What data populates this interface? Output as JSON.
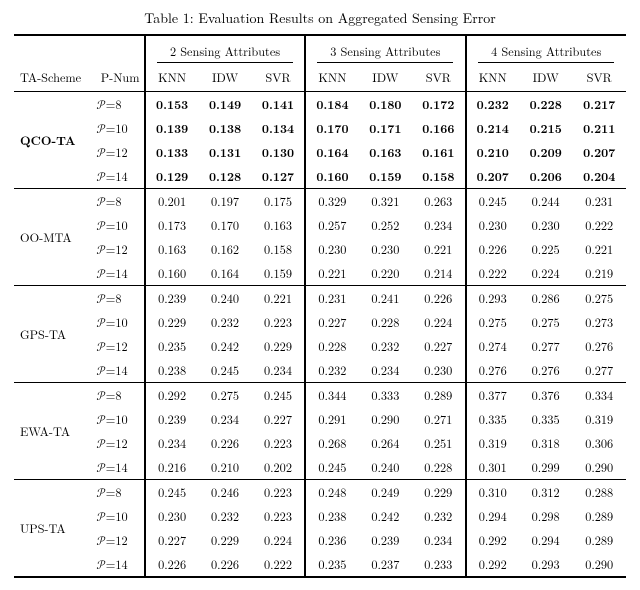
{
  "caption": "Table 1: Evaluation Results on Aggregated Sensing Error",
  "header": {
    "scheme": "TA-Scheme",
    "pnum": "P-Num",
    "groups": [
      "2 Sensing Attributes",
      "3 Sensing Attributes",
      "4 Sensing Attributes"
    ],
    "metrics": [
      "KNN",
      "IDW",
      "SVR"
    ]
  },
  "pnum_values": [
    "=8",
    "=10",
    "=12",
    "=14"
  ],
  "schemes": [
    {
      "name": "QCO-TA",
      "bold": true,
      "rows": [
        [
          "0.153",
          "0.149",
          "0.141",
          "0.184",
          "0.180",
          "0.172",
          "0.232",
          "0.228",
          "0.217"
        ],
        [
          "0.139",
          "0.138",
          "0.134",
          "0.170",
          "0.171",
          "0.166",
          "0.214",
          "0.215",
          "0.211"
        ],
        [
          "0.133",
          "0.131",
          "0.130",
          "0.164",
          "0.163",
          "0.161",
          "0.210",
          "0.209",
          "0.207"
        ],
        [
          "0.129",
          "0.128",
          "0.127",
          "0.160",
          "0.159",
          "0.158",
          "0.207",
          "0.206",
          "0.204"
        ]
      ]
    },
    {
      "name": "OO-MTA",
      "bold": false,
      "rows": [
        [
          "0.201",
          "0.197",
          "0.175",
          "0.329",
          "0.321",
          "0.263",
          "0.245",
          "0.244",
          "0.231"
        ],
        [
          "0.173",
          "0.170",
          "0.163",
          "0.257",
          "0.252",
          "0.234",
          "0.230",
          "0.230",
          "0.222"
        ],
        [
          "0.163",
          "0.162",
          "0.158",
          "0.230",
          "0.230",
          "0.221",
          "0.226",
          "0.225",
          "0.221"
        ],
        [
          "0.160",
          "0.164",
          "0.159",
          "0.221",
          "0.220",
          "0.214",
          "0.222",
          "0.224",
          "0.219"
        ]
      ]
    },
    {
      "name": "GPS-TA",
      "bold": false,
      "rows": [
        [
          "0.239",
          "0.240",
          "0.221",
          "0.231",
          "0.241",
          "0.226",
          "0.293",
          "0.286",
          "0.275"
        ],
        [
          "0.229",
          "0.232",
          "0.223",
          "0.227",
          "0.228",
          "0.224",
          "0.275",
          "0.275",
          "0.273"
        ],
        [
          "0.235",
          "0.242",
          "0.229",
          "0.228",
          "0.232",
          "0.227",
          "0.274",
          "0.277",
          "0.276"
        ],
        [
          "0.238",
          "0.245",
          "0.234",
          "0.232",
          "0.234",
          "0.230",
          "0.276",
          "0.276",
          "0.277"
        ]
      ]
    },
    {
      "name": "EWA-TA",
      "bold": false,
      "rows": [
        [
          "0.292",
          "0.275",
          "0.245",
          "0.344",
          "0.333",
          "0.289",
          "0.377",
          "0.376",
          "0.334"
        ],
        [
          "0.239",
          "0.234",
          "0.227",
          "0.291",
          "0.290",
          "0.271",
          "0.335",
          "0.335",
          "0.319"
        ],
        [
          "0.234",
          "0.226",
          "0.223",
          "0.268",
          "0.264",
          "0.251",
          "0.319",
          "0.318",
          "0.306"
        ],
        [
          "0.216",
          "0.210",
          "0.202",
          "0.245",
          "0.240",
          "0.228",
          "0.301",
          "0.299",
          "0.290"
        ]
      ]
    },
    {
      "name": "UPS-TA",
      "bold": false,
      "rows": [
        [
          "0.245",
          "0.246",
          "0.223",
          "0.248",
          "0.249",
          "0.229",
          "0.310",
          "0.312",
          "0.288"
        ],
        [
          "0.230",
          "0.232",
          "0.223",
          "0.238",
          "0.242",
          "0.232",
          "0.294",
          "0.298",
          "0.289"
        ],
        [
          "0.227",
          "0.229",
          "0.224",
          "0.236",
          "0.239",
          "0.234",
          "0.292",
          "0.294",
          "0.289"
        ],
        [
          "0.226",
          "0.226",
          "0.222",
          "0.235",
          "0.237",
          "0.233",
          "0.292",
          "0.293",
          "0.290"
        ]
      ]
    }
  ],
  "chart_data": {
    "type": "table",
    "title": "Evaluation Results on Aggregated Sensing Error",
    "row_groups": [
      "QCO-TA",
      "OO-MTA",
      "GPS-TA",
      "EWA-TA",
      "UPS-TA"
    ],
    "row_sub": [
      "P=8",
      "P=10",
      "P=12",
      "P=14"
    ],
    "col_groups": [
      "2 Sensing Attributes",
      "3 Sensing Attributes",
      "4 Sensing Attributes"
    ],
    "col_sub": [
      "KNN",
      "IDW",
      "SVR"
    ],
    "values": [
      [
        [
          0.153,
          0.149,
          0.141
        ],
        [
          0.184,
          0.18,
          0.172
        ],
        [
          0.232,
          0.228,
          0.217
        ]
      ],
      [
        [
          0.139,
          0.138,
          0.134
        ],
        [
          0.17,
          0.171,
          0.166
        ],
        [
          0.214,
          0.215,
          0.211
        ]
      ],
      [
        [
          0.133,
          0.131,
          0.13
        ],
        [
          0.164,
          0.163,
          0.161
        ],
        [
          0.21,
          0.209,
          0.207
        ]
      ],
      [
        [
          0.129,
          0.128,
          0.127
        ],
        [
          0.16,
          0.159,
          0.158
        ],
        [
          0.207,
          0.206,
          0.204
        ]
      ],
      [
        [
          0.201,
          0.197,
          0.175
        ],
        [
          0.329,
          0.321,
          0.263
        ],
        [
          0.245,
          0.244,
          0.231
        ]
      ],
      [
        [
          0.173,
          0.17,
          0.163
        ],
        [
          0.257,
          0.252,
          0.234
        ],
        [
          0.23,
          0.23,
          0.222
        ]
      ],
      [
        [
          0.163,
          0.162,
          0.158
        ],
        [
          0.23,
          0.23,
          0.221
        ],
        [
          0.226,
          0.225,
          0.221
        ]
      ],
      [
        [
          0.16,
          0.164,
          0.159
        ],
        [
          0.221,
          0.22,
          0.214
        ],
        [
          0.222,
          0.224,
          0.219
        ]
      ],
      [
        [
          0.239,
          0.24,
          0.221
        ],
        [
          0.231,
          0.241,
          0.226
        ],
        [
          0.293,
          0.286,
          0.275
        ]
      ],
      [
        [
          0.229,
          0.232,
          0.223
        ],
        [
          0.227,
          0.228,
          0.224
        ],
        [
          0.275,
          0.275,
          0.273
        ]
      ],
      [
        [
          0.235,
          0.242,
          0.229
        ],
        [
          0.228,
          0.232,
          0.227
        ],
        [
          0.274,
          0.277,
          0.276
        ]
      ],
      [
        [
          0.238,
          0.245,
          0.234
        ],
        [
          0.232,
          0.234,
          0.23
        ],
        [
          0.276,
          0.276,
          0.277
        ]
      ],
      [
        [
          0.292,
          0.275,
          0.245
        ],
        [
          0.344,
          0.333,
          0.289
        ],
        [
          0.377,
          0.376,
          0.334
        ]
      ],
      [
        [
          0.239,
          0.234,
          0.227
        ],
        [
          0.291,
          0.29,
          0.271
        ],
        [
          0.335,
          0.335,
          0.319
        ]
      ],
      [
        [
          0.234,
          0.226,
          0.223
        ],
        [
          0.268,
          0.264,
          0.251
        ],
        [
          0.319,
          0.318,
          0.306
        ]
      ],
      [
        [
          0.216,
          0.21,
          0.202
        ],
        [
          0.245,
          0.24,
          0.228
        ],
        [
          0.301,
          0.299,
          0.29
        ]
      ],
      [
        [
          0.245,
          0.246,
          0.223
        ],
        [
          0.248,
          0.249,
          0.229
        ],
        [
          0.31,
          0.312,
          0.288
        ]
      ],
      [
        [
          0.23,
          0.232,
          0.223
        ],
        [
          0.238,
          0.242,
          0.232
        ],
        [
          0.294,
          0.298,
          0.289
        ]
      ],
      [
        [
          0.227,
          0.229,
          0.224
        ],
        [
          0.236,
          0.239,
          0.234
        ],
        [
          0.292,
          0.294,
          0.289
        ]
      ],
      [
        [
          0.226,
          0.226,
          0.222
        ],
        [
          0.235,
          0.237,
          0.233
        ],
        [
          0.292,
          0.293,
          0.29
        ]
      ]
    ]
  }
}
